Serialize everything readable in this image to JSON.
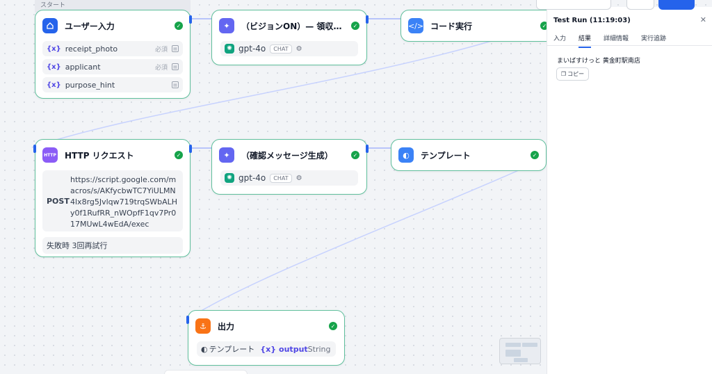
{
  "canvas": {
    "start_label": "スタート"
  },
  "nodes": {
    "user_input": {
      "title": "ユーザー入力",
      "variables": [
        {
          "name": "receipt_photo",
          "required": "必須"
        },
        {
          "name": "applicant",
          "required": "必須"
        },
        {
          "name": "purpose_hint",
          "required": ""
        }
      ]
    },
    "llm_vision": {
      "title": "（ビジョンON）— 領収書か...",
      "model": "gpt-4o",
      "mode": "CHAT"
    },
    "code_exec": {
      "title": "コード実行"
    },
    "http_request": {
      "title": "HTTP リクエスト",
      "icon_text": "HTTP",
      "method": "POST",
      "url": "https://script.google.com/macros/s/AKfycbwTC7YiULMN4lx8rg5Jvlqw719trqSWbALHy0f1RufRR_nWOpfF1qv7Pr017MUwL4wEdA/exec",
      "retry": "失敗時 3回再試行"
    },
    "llm_confirm": {
      "title": "（確認メッセージ生成）",
      "model": "gpt-4o",
      "mode": "CHAT"
    },
    "template": {
      "title": "テンプレート"
    },
    "output": {
      "title": "出力",
      "source_node": "テンプレート",
      "var_prefix": "{x}",
      "var_name": "output",
      "var_type": "String"
    }
  },
  "panel": {
    "title": "Test Run (11:19:03)",
    "tabs": [
      "入力",
      "結果",
      "詳細情報",
      "実行追跡"
    ],
    "active_tab": "結果",
    "result": "まいばすけっと 黄金町駅南店",
    "copy_label": "コピー"
  },
  "colors": {
    "node_border": "#5fbf9c",
    "accent": "#2563eb",
    "success": "#16a34a"
  }
}
